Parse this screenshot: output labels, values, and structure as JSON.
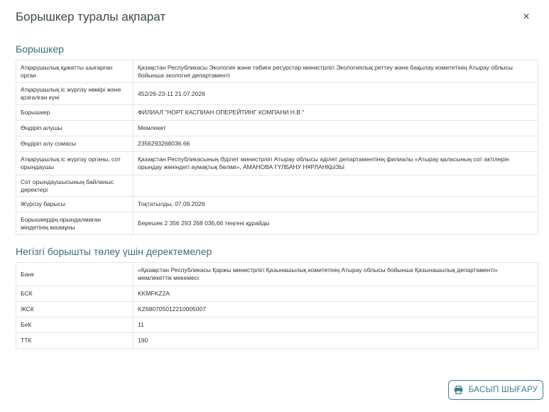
{
  "modal": {
    "title": "Борышкер туралы ақпарат",
    "close_symbol": "×"
  },
  "debtor_section": {
    "title": "Борышкер",
    "rows": [
      {
        "label": "Атқарушылық құжатты шығарған орган",
        "value": "Қазақстан Республикасы Экология және табиғи ресурстар министрлігі Экологиялық реттеу және бақылау комитетінің Атырау облысы бойынша экология департаменті"
      },
      {
        "label": "Атқарушылық іс жүргізу нөмірі және қозғалған күні",
        "value": "452/26-23-11 21.07.2026"
      },
      {
        "label": "Борышкер",
        "value": "ФИЛИАЛ \"НОРТ КАСПИАН ОПЕРЕЙТИНГ КОМПАНИ Н.В.\""
      },
      {
        "label": "Өндіріп алушы",
        "value": "Мемлекет"
      },
      {
        "label": "Өндіріп алу сомасы",
        "value": "2356293268036.66"
      },
      {
        "label": "Атқарушылық іс жүргізу органы, сот орындаушы",
        "value": "Қазақстан Республикасының Әділет министрлігі Атырау облысы әділет департаментінің филиалы «Атырау қаласының сот актілерін орындау жөніндегі аумақтық бөлімі», АМАНОВА ГҮЛБАНУ НҰРЛАНҚЫЗЫ"
      },
      {
        "label": "Сот орындаушысының байланыс деректері",
        "value": ""
      },
      {
        "label": "Жүргізу барысы",
        "value": "Тоқтатылды, 07.09.2026"
      },
      {
        "label": "Борышкердің орындалмаған міндетінің мазмұны",
        "value": "Берешек 2 356 293 268 036,66 теңгені құрайды"
      }
    ]
  },
  "payment_section": {
    "title": "Негізгі борышты төлеу үшін деректемелер",
    "rows": [
      {
        "label": "Банк",
        "value": "«Қазақстан Республикасы Қаржы министрлігі Қазынашылық комитетінің Атырау облысы бойынша Қазынашылық департаменті» мемлекеттік мекемесі"
      },
      {
        "label": "БСК",
        "value": "KKMFKZ2A"
      },
      {
        "label": "ЖСК",
        "value": "KZ680705012210005007"
      },
      {
        "label": "БеК",
        "value": "11"
      },
      {
        "label": "ТТК",
        "value": "190"
      }
    ]
  },
  "actions": {
    "print_label": "БАСЫП ШЫҒАРУ",
    "print_icon": "printer-icon"
  },
  "colors": {
    "title": "#3a4750",
    "section_title": "#3d6b7a",
    "button_accent": "#3d7c90",
    "table_border": "#e3e6e8"
  }
}
